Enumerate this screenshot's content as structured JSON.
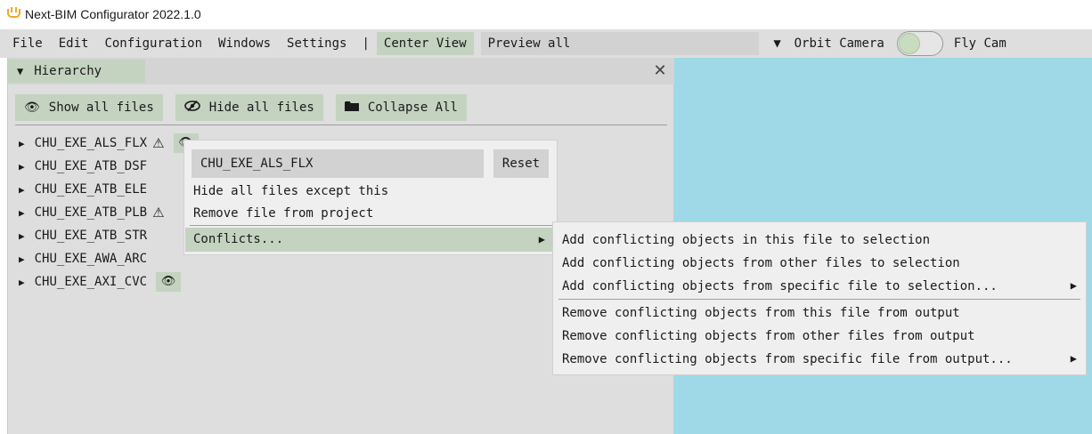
{
  "window": {
    "title": "Next-BIM Configurator 2022.1.0",
    "icon": "vr-headset-icon"
  },
  "menubar": {
    "items": [
      "File",
      "Edit",
      "Configuration",
      "Windows",
      "Settings"
    ],
    "separator": "|",
    "center_view": "Center View",
    "preview_all": "Preview all",
    "camera_dropdown_glyph": "▼",
    "orbit_camera": "Orbit Camera",
    "fly_camera": "Fly Cam"
  },
  "hierarchy": {
    "tab_glyph": "▼",
    "tab_label": "Hierarchy",
    "close_glyph": "✕",
    "toolbar": {
      "show_all": "Show all files",
      "show_icon": "eye-icon",
      "hide_all": "Hide all files",
      "hide_icon": "eye-slash-icon",
      "collapse_all": "Collapse All",
      "collapse_icon": "folder-icon"
    },
    "files": [
      {
        "name": "CHU_EXE_ALS_FLX",
        "warning": true,
        "eye": true
      },
      {
        "name": "CHU_EXE_ATB_DSF",
        "warning": false,
        "eye": false
      },
      {
        "name": "CHU_EXE_ATB_ELE",
        "warning": false,
        "eye": false
      },
      {
        "name": "CHU_EXE_ATB_PLB",
        "warning": true,
        "eye": false
      },
      {
        "name": "CHU_EXE_ATB_STR",
        "warning": false,
        "eye": false
      },
      {
        "name": "CHU_EXE_AWA_ARC",
        "warning": false,
        "eye": false
      },
      {
        "name": "CHU_EXE_AXI_CVC",
        "warning": false,
        "eye": true
      }
    ]
  },
  "context_menu": {
    "file_name": "CHU_EXE_ALS_FLX",
    "reset": "Reset",
    "hide_except": "Hide all files except this",
    "remove_file": "Remove file from project",
    "conflicts": "Conflicts...",
    "submenu_arrow": "▶"
  },
  "conflicts_submenu": {
    "add_this": "Add conflicting objects in this file to selection",
    "add_other": "Add conflicting objects from other files to selection",
    "add_specific": "Add conflicting objects from specific file to selection...",
    "remove_this": "Remove conflicting objects from this file from output",
    "remove_other": "Remove conflicting objects from other files from output",
    "remove_specific": "Remove conflicting objects from specific file from output...",
    "arrow": "▶"
  },
  "colors": {
    "panel_bg": "#dedede",
    "accent_green": "#c3d3c0",
    "viewport_blue": "#9fd9e7",
    "menu_bg": "#efefef",
    "icon_orange": "#f5a623"
  }
}
